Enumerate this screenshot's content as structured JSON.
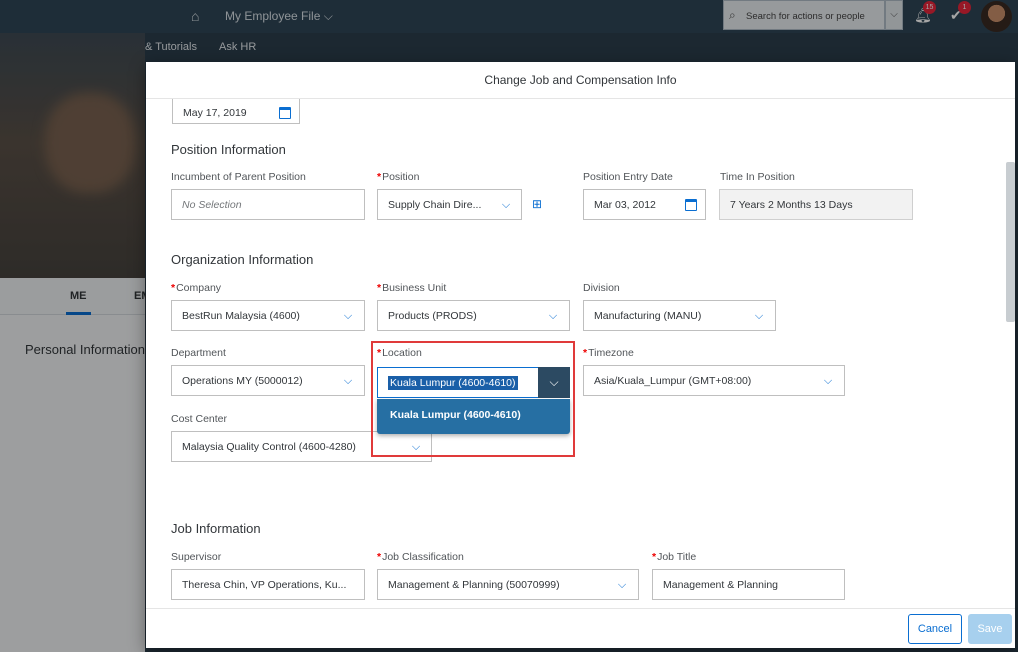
{
  "shell": {
    "title": "My Employee File",
    "search_placeholder": "Search for actions or people",
    "notifications_count": "15",
    "approvals_count": "1",
    "subnav": [
      "& Tutorials",
      "Ask HR"
    ]
  },
  "profile": {
    "tabs": [
      "ME",
      "EM"
    ],
    "section": "Personal Information"
  },
  "dialog": {
    "title": "Change Job and Compensation Info",
    "top_date": "May 17, 2019",
    "position_info": {
      "title": "Position Information",
      "incumbent_label": "Incumbent of Parent Position",
      "incumbent_value": "No Selection",
      "position_label": "Position",
      "position_value": "Supply Chain Dire...",
      "entry_label": "Position Entry Date",
      "entry_value": "Mar 03, 2012",
      "time_label": "Time In Position",
      "time_value": "7 Years 2 Months 13 Days"
    },
    "org_info": {
      "title": "Organization Information",
      "company_label": "Company",
      "company_value": "BestRun Malaysia (4600)",
      "bu_label": "Business Unit",
      "bu_value": "Products (PRODS)",
      "division_label": "Division",
      "division_value": "Manufacturing (MANU)",
      "dept_label": "Department",
      "dept_value": "Operations MY (5000012)",
      "location_label": "Location",
      "location_value": "Kuala Lumpur (4600-4610)",
      "location_option": "Kuala Lumpur (4600-4610)",
      "timezone_label": "Timezone",
      "timezone_value": "Asia/Kuala_Lumpur (GMT+08:00)",
      "cost_label": "Cost Center",
      "cost_value": "Malaysia Quality Control (4600-4280)"
    },
    "job_info": {
      "title": "Job Information",
      "supervisor_label": "Supervisor",
      "supervisor_value": "Theresa Chin, VP Operations, Ku...",
      "class_label": "Job Classification",
      "class_value": "Management & Planning (50070999)",
      "jobtitle_label": "Job Title",
      "jobtitle_value": "Management & Planning"
    },
    "cancel_label": "Cancel",
    "save_label": "Save"
  },
  "colors": {
    "accent": "#0a6ed1",
    "highlight": "#e03a3a",
    "shell": "#2f4656"
  }
}
